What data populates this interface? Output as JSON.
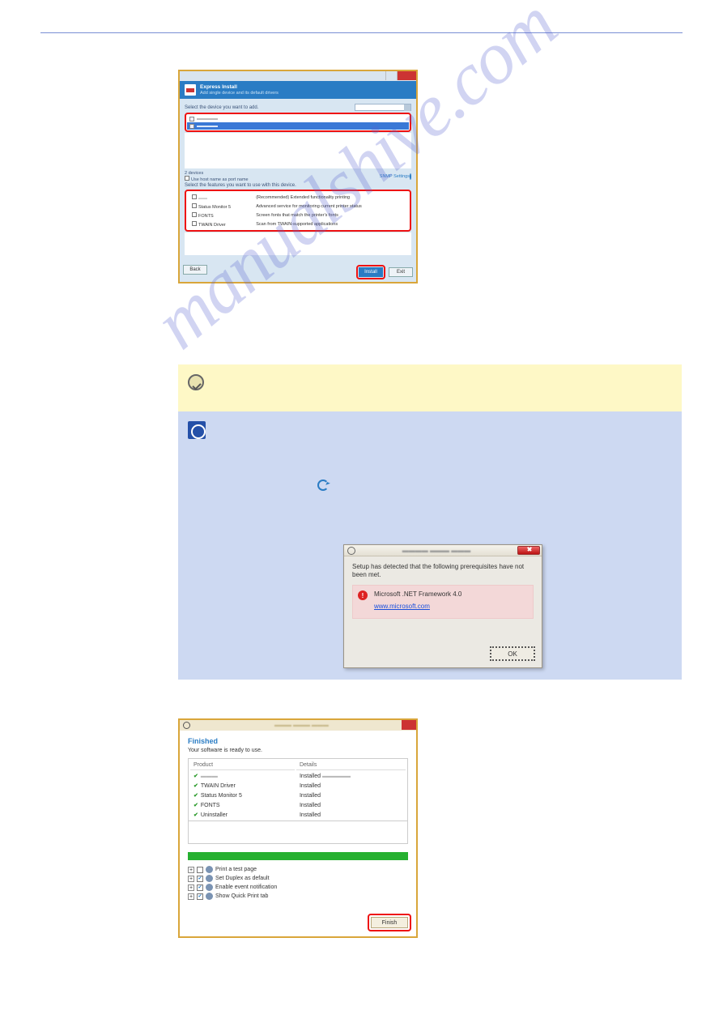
{
  "win1": {
    "header_title": "Express Install",
    "header_sub": "Add single device and its default drivers",
    "section_select_device": "Select the device you want to add.",
    "devices_col2_header": "",
    "device_count_label": "2 devices",
    "use_hostname": "Use host name as port name",
    "snmp_label": "SNMP Settings",
    "section_features": "Select the features you want to use with this device.",
    "feat": [
      {
        "name": "",
        "desc": "(Recommended) Extended functionality printing"
      },
      {
        "name": "Status Monitor 5",
        "desc": "Advanced service for monitoring current printer status"
      },
      {
        "name": "FONTS",
        "desc": "Screen fonts that match the printer's fonts"
      },
      {
        "name": "TWAIN Driver",
        "desc": "Scan from TWAIN-supported applications"
      }
    ],
    "btn_back": "Back",
    "btn_install": "Install",
    "btn_exit": "Exit"
  },
  "dlg": {
    "msg": "Setup has detected that the following prerequisites have not been met.",
    "prereq_name": "Microsoft .NET Framework 4.0",
    "link": "www.microsoft.com",
    "ok": "OK"
  },
  "win3": {
    "title": "Finished",
    "sub": "Your software is ready to use.",
    "col_product": "Product",
    "col_details": "Details",
    "rows": [
      {
        "name": "",
        "detail": "Installed"
      },
      {
        "name": "TWAIN Driver",
        "detail": "Installed"
      },
      {
        "name": "Status Monitor 5",
        "detail": "Installed"
      },
      {
        "name": "FONTS",
        "detail": "Installed"
      },
      {
        "name": "Uninstaller",
        "detail": "Installed"
      }
    ],
    "opts": [
      {
        "label": "Print a test page",
        "checked": false
      },
      {
        "label": "Set Duplex as default",
        "checked": true
      },
      {
        "label": "Enable event notification",
        "checked": true
      },
      {
        "label": "Show Quick Print tab",
        "checked": true
      }
    ],
    "finish": "Finish"
  },
  "watermark": "manualshive.com"
}
